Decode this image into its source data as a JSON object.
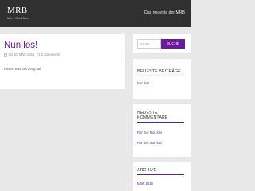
{
  "site": {
    "title": "MRB",
    "tagline": "Men's Rock Band"
  },
  "nav": {
    "item": "Das neueste der MRB"
  },
  "post": {
    "title": "Nun los!",
    "date": "On 10. März 2018",
    "comments": "2 Comments",
    "excerpt": "Posten was das Zeug hält"
  },
  "search": {
    "placeholder": "Suche",
    "button": "SUCHE"
  },
  "widgets": {
    "recent_posts": {
      "title": "NEUESTE BEITRÄGE",
      "items": [
        "Nun los!"
      ]
    },
    "recent_comments": {
      "title_line1": "NEUESTE",
      "title_line2": "KOMMENTARE",
      "items": [
        {
          "author": "Ron",
          "connector": "bei",
          "post": "Nun los!"
        },
        {
          "author": "Ron",
          "connector": "bei",
          "post": "Nun los!"
        }
      ]
    },
    "archive": {
      "title": "ARCHIVE",
      "items": [
        "März 2018"
      ]
    }
  },
  "colors": {
    "accent": "#6a1b9a",
    "header_bg": "#303030",
    "page_bg": "#e8e8e8"
  },
  "icons": {
    "date": "calendar-icon",
    "comments": "comment-icon"
  }
}
